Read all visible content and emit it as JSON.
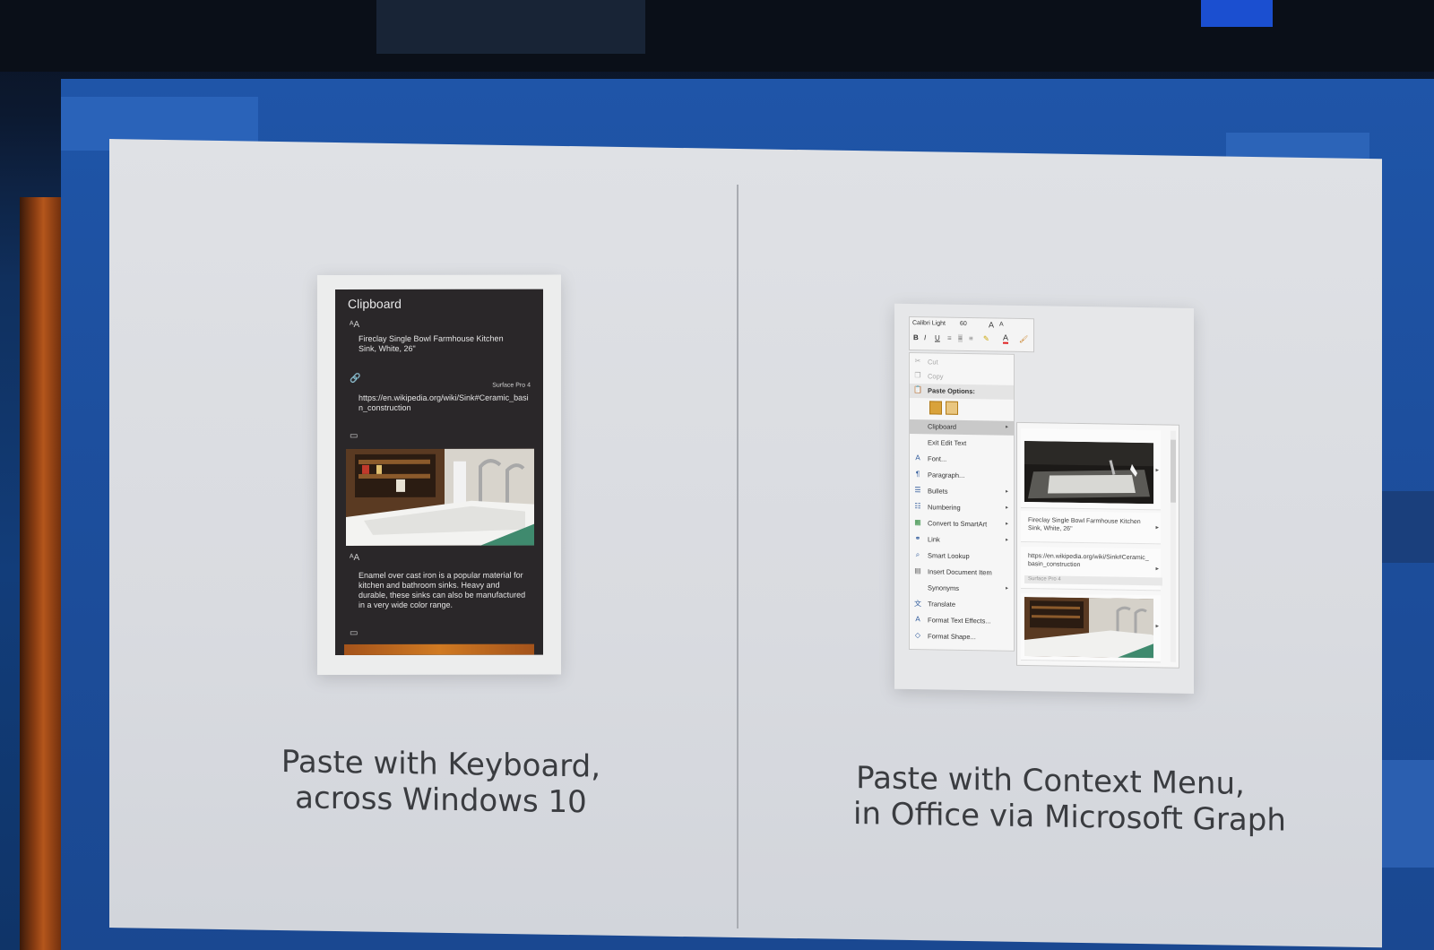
{
  "left": {
    "panel_title": "Clipboard",
    "items": [
      {
        "type": "text",
        "icon": "text-icon",
        "text": "Fireclay Single Bowl Farmhouse Kitchen Sink, White, 26\""
      },
      {
        "type": "link",
        "icon": "link-icon",
        "source": "Surface Pro 4",
        "text": "https://en.wikipedia.org/wiki/Sink#Ceramic_basin_construction"
      },
      {
        "type": "image",
        "icon": "image-icon"
      },
      {
        "type": "text",
        "icon": "text-icon",
        "text": "Enamel over cast iron is a popular material for kitchen and bathroom sinks. Heavy and durable, these sinks can also be manufactured in a very wide color range."
      },
      {
        "type": "image",
        "icon": "image-icon"
      }
    ],
    "caption_line1": "Paste with Keyboard,",
    "caption_line2": "across Windows 10"
  },
  "right": {
    "toolbar": {
      "font_name": "Calibri Light",
      "font_size": "60",
      "bold": "B",
      "italic": "I",
      "underline": "U",
      "grow_font": "A",
      "shrink_font": "A",
      "font_color": "A"
    },
    "menu": [
      {
        "label": "Cut",
        "icon": "scissors-icon",
        "disabled": true
      },
      {
        "label": "Copy",
        "icon": "copy-icon",
        "disabled": true
      },
      {
        "label": "Paste Options:",
        "icon": "paste-icon",
        "header": true
      },
      {
        "label": "",
        "icon": "paste-options-icons",
        "paste_row": true
      },
      {
        "label": "Clipboard",
        "icon": "",
        "submenu": true,
        "selected": true
      },
      {
        "label": "Exit Edit Text",
        "icon": ""
      },
      {
        "label": "Font...",
        "icon": "font-icon"
      },
      {
        "label": "Paragraph...",
        "icon": "paragraph-icon"
      },
      {
        "label": "Bullets",
        "icon": "bullets-icon",
        "submenu": true
      },
      {
        "label": "Numbering",
        "icon": "numbering-icon",
        "submenu": true
      },
      {
        "label": "Convert to SmartArt",
        "icon": "smartart-icon",
        "submenu": true
      },
      {
        "label": "Link",
        "icon": "link-icon",
        "submenu": true
      },
      {
        "label": "Smart Lookup",
        "icon": "search-icon"
      },
      {
        "label": "Insert Document Item",
        "icon": "insert-doc-icon"
      },
      {
        "label": "Synonyms",
        "icon": "",
        "submenu": true
      },
      {
        "label": "Translate",
        "icon": "translate-icon"
      },
      {
        "label": "Format Text Effects...",
        "icon": "text-effects-icon"
      },
      {
        "label": "Format Shape...",
        "icon": "format-shape-icon"
      }
    ],
    "flyout": {
      "text_item": "Fireclay Single Bowl Farmhouse Kitchen Sink, White, 26\"",
      "link_item": "https://en.wikipedia.org/wiki/Sink#Ceramic_basin_construction",
      "link_source": "Surface Pro 4"
    },
    "caption_line1": "Paste with Context Menu,",
    "caption_line2": "in Office via Microsoft Graph"
  }
}
